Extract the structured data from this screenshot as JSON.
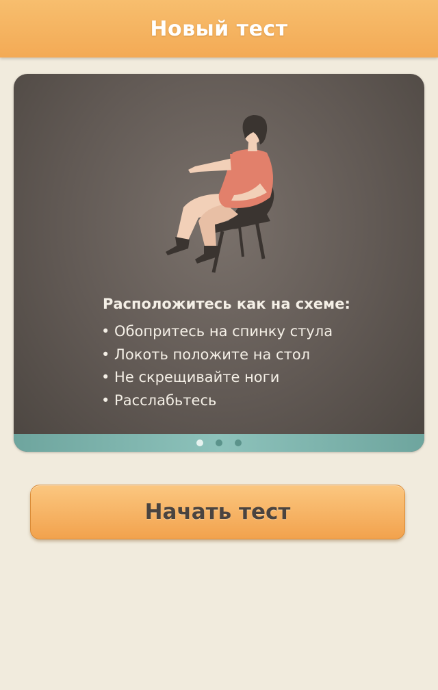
{
  "navbar": {
    "title": "Новый тест"
  },
  "instructions": {
    "title": "Расположитесь как на схеме:",
    "steps": [
      "• Обопритесь на спинку стула",
      "• Локоть положите на стол",
      "• Не скрещивайте ноги",
      "• Расслабьтесь"
    ]
  },
  "pager": {
    "pages": 3,
    "active": 1
  },
  "start_button": {
    "label": "Начать тест"
  },
  "colors": {
    "accent": "#f3aa55",
    "card": "#615954",
    "pager_bar": "#8dc2bb",
    "background": "#f1ebdd"
  },
  "icons": {
    "illustration": "person-sitting-on-chair-illustration"
  }
}
